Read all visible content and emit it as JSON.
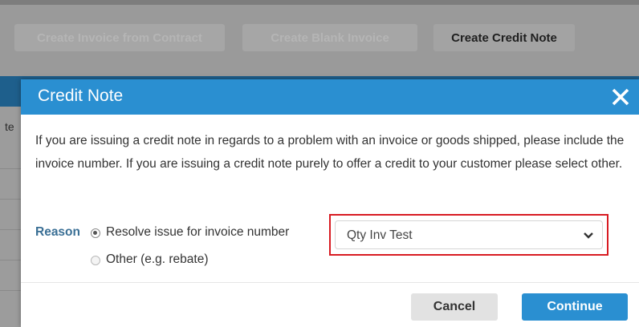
{
  "toolbar": {
    "create_from_contract": "Create Invoice from Contract",
    "create_blank": "Create Blank Invoice",
    "create_credit_note": "Create Credit Note"
  },
  "background": {
    "side_text": "te"
  },
  "modal": {
    "title": "Credit Note",
    "close_icon": "close-icon",
    "description": "If you are issuing a credit note in regards to a problem with an invoice or goods shipped, please include the invoice number. If you are issuing a credit note purely to offer a credit to your customer please select other.",
    "reason_label": "Reason",
    "options": [
      {
        "label": "Resolve issue for invoice number",
        "checked": true
      },
      {
        "label": "Other (e.g. rebate)",
        "checked": false
      }
    ],
    "invoice_select": {
      "value": "Qty Inv Test"
    },
    "buttons": {
      "cancel": "Cancel",
      "continue": "Continue"
    }
  },
  "colors": {
    "header_blue": "#2a8fd1",
    "highlight_red": "#d81b22",
    "reason_label": "#3a6f95"
  }
}
